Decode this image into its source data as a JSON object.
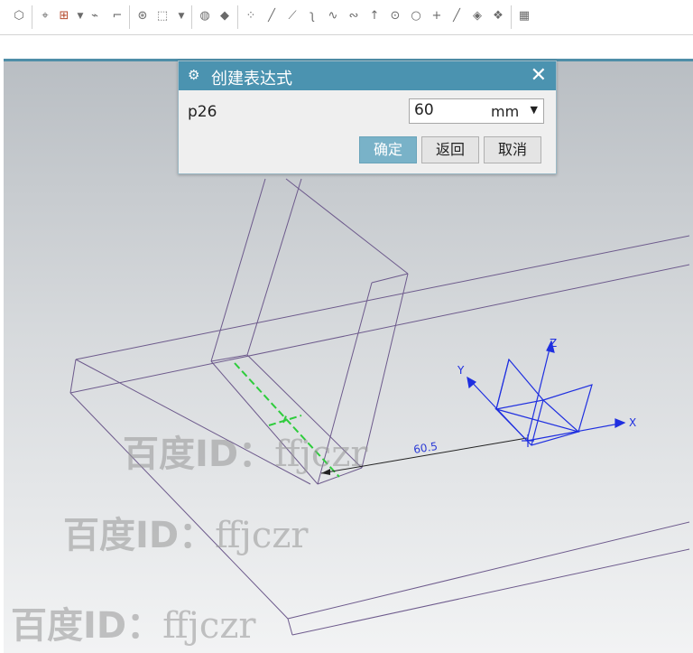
{
  "toolbar": {
    "icons": [
      "shape-icon",
      "snap-icon",
      "select-box-icon",
      "dropdown-icon",
      "point-icon",
      "edge-icon",
      "filter-icon",
      "rectangle-select-icon",
      "dropdown-icon",
      "solid-icon",
      "cube-icon",
      "scatter-icon",
      "line-icon",
      "line-icon",
      "curve-icon",
      "spline-icon",
      "wave-icon",
      "arrow-up-icon",
      "circle-dot-icon",
      "circle-icon",
      "plus-icon",
      "diagonal-icon",
      "tool-icon",
      "tool-icon",
      "grid-icon"
    ]
  },
  "dialog": {
    "title": "创建表达式",
    "parameter_name": "p26",
    "value": "60",
    "unit": "mm",
    "buttons": {
      "ok": "确定",
      "back": "返回",
      "cancel": "取消"
    }
  },
  "viewport": {
    "dimension_label": "60.5",
    "axes": {
      "x": "X",
      "y": "Y",
      "z": "Z"
    }
  },
  "watermarks": [
    {
      "prefix": "百度ID：",
      "name": "ffjczr"
    },
    {
      "prefix": "百度ID：",
      "name": "ffjczr"
    },
    {
      "prefix": "百度ID：",
      "name": "ffjczr"
    }
  ]
}
